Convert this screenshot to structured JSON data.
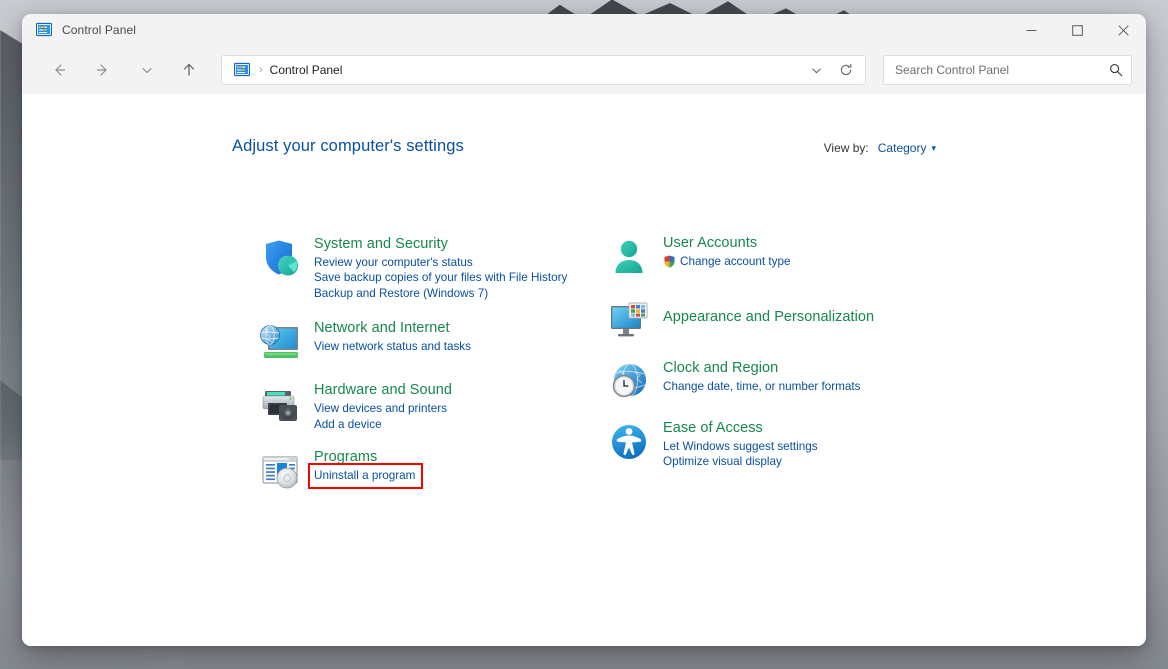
{
  "window": {
    "title": "Control Panel",
    "title_icon": "control-panel-icon",
    "controls": {
      "minimize": "─",
      "maximize": "□",
      "close": "×"
    }
  },
  "navbar": {
    "back_icon": "arrow-left-icon",
    "forward_icon": "arrow-right-icon",
    "recent_icon": "chevron-down-icon",
    "up_icon": "arrow-up-icon",
    "address": {
      "icon": "control-panel-icon",
      "separator": "›",
      "path": "Control Panel",
      "dropdown_icon": "chevron-down-icon",
      "refresh_icon": "refresh-icon"
    },
    "search": {
      "placeholder": "Search Control Panel",
      "value": "",
      "icon": "search-icon"
    }
  },
  "main": {
    "heading": "Adjust your computer's settings",
    "view_by": {
      "label": "View by:",
      "value": "Category",
      "caret": "▾"
    },
    "columns": {
      "left": [
        {
          "id": "system-and-security",
          "icon": "shield-icon",
          "title": "System and Security",
          "links": [
            {
              "text": "Review your computer's status",
              "highlighted": false,
              "shield": false
            },
            {
              "text": "Save backup copies of your files with File History",
              "highlighted": false,
              "shield": false
            },
            {
              "text": "Backup and Restore (Windows 7)",
              "highlighted": false,
              "shield": false
            }
          ]
        },
        {
          "id": "network-and-internet",
          "icon": "network-icon",
          "title": "Network and Internet",
          "links": [
            {
              "text": "View network status and tasks",
              "highlighted": false,
              "shield": false
            }
          ]
        },
        {
          "id": "hardware-and-sound",
          "icon": "printer-icon",
          "title": "Hardware and Sound",
          "links": [
            {
              "text": "View devices and printers",
              "highlighted": false,
              "shield": false
            },
            {
              "text": "Add a device",
              "highlighted": false,
              "shield": false
            }
          ]
        },
        {
          "id": "programs",
          "icon": "programs-icon",
          "title": "Programs",
          "links": [
            {
              "text": "Uninstall a program",
              "highlighted": true,
              "shield": false
            }
          ]
        }
      ],
      "right": [
        {
          "id": "user-accounts",
          "icon": "user-icon",
          "title": "User Accounts",
          "links": [
            {
              "text": "Change account type",
              "highlighted": false,
              "shield": true
            }
          ]
        },
        {
          "id": "appearance-and-personalization",
          "icon": "appearance-icon",
          "title": "Appearance and Personalization",
          "links": []
        },
        {
          "id": "clock-and-region",
          "icon": "clock-globe-icon",
          "title": "Clock and Region",
          "links": [
            {
              "text": "Change date, time, or number formats",
              "highlighted": false,
              "shield": false
            }
          ]
        },
        {
          "id": "ease-of-access",
          "icon": "accessibility-icon",
          "title": "Ease of Access",
          "links": [
            {
              "text": "Let Windows suggest settings",
              "highlighted": false,
              "shield": false
            },
            {
              "text": "Optimize visual display",
              "highlighted": false,
              "shield": false
            }
          ]
        }
      ]
    }
  },
  "colors": {
    "category_title": "#16874e",
    "link": "#0a50a1",
    "heading": "#0a50a1",
    "highlight_border": "#ff0000",
    "titlebar_bg": "#f3f3f3"
  }
}
